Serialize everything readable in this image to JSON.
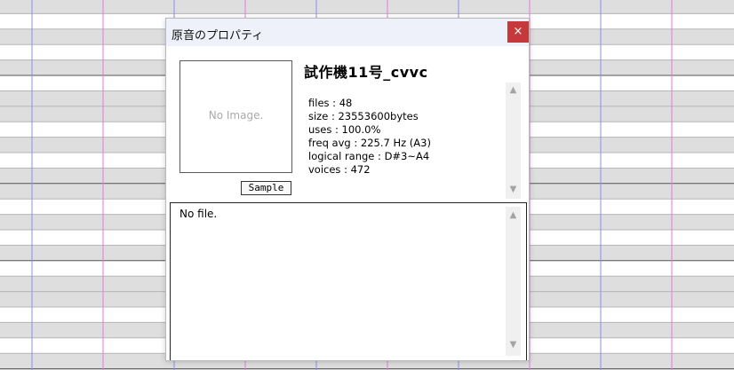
{
  "dialog": {
    "title": "原音のプロパティ",
    "close_label": "×"
  },
  "voicebank": {
    "image_placeholder": "No Image.",
    "sample_label": "Sample",
    "name": "試作機11号_cvvc",
    "info": [
      "files : 48",
      "size :  23553600bytes",
      "uses : 100.0%",
      "freq avg : 225.7 Hz (A3)",
      "logical range : D#3~A4",
      "voices : 472"
    ]
  },
  "readme": {
    "text": "No file."
  },
  "scrollbar": {
    "up_icon": "▲",
    "down_icon": "▼"
  },
  "colors": {
    "close_button": "#c5393c",
    "titlebar": "#eef1f9",
    "grid_blue": "#8c8cf0",
    "grid_magenta": "#e07ae0"
  }
}
